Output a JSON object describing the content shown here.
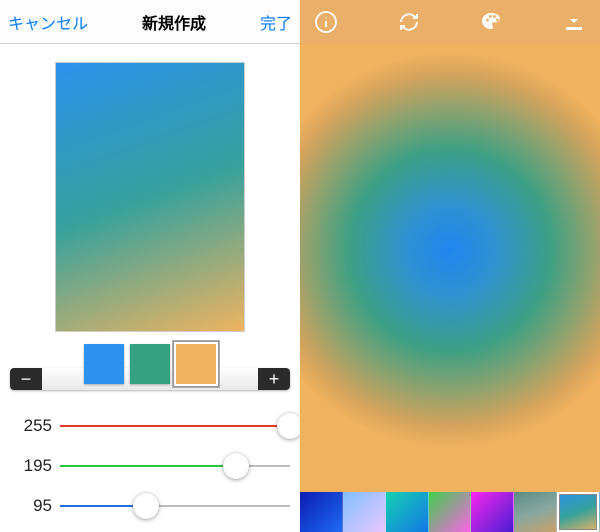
{
  "left": {
    "nav": {
      "cancel": "キャンセル",
      "title": "新規作成",
      "done": "完了"
    },
    "preview_gradient": "linear-gradient(160deg, #2b93ef 0%, #36a19c 50%, #f0b35f 100%)",
    "tray": {
      "minus": "−",
      "plus": "+"
    },
    "swatches": [
      {
        "color": "#2b93ef",
        "selected": false
      },
      {
        "color": "#36a17f",
        "selected": false
      },
      {
        "color": "#f0b35f",
        "selected": true
      }
    ],
    "sliders": [
      {
        "channel": "red",
        "value": 255,
        "pct": 100.0
      },
      {
        "channel": "green",
        "value": 195,
        "pct": 76.5
      },
      {
        "channel": "blue",
        "value": 95,
        "pct": 37.3
      }
    ]
  },
  "right": {
    "thumbs": [
      {
        "style": "linear-gradient(135deg,#0b1db0,#1f6af5)",
        "selected": false
      },
      {
        "style": "linear-gradient(135deg,#7fbfff,#e9c6ff)",
        "selected": false
      },
      {
        "style": "linear-gradient(135deg,#15d0b1,#1278e5)",
        "selected": false
      },
      {
        "style": "linear-gradient(135deg,#3ecf4a,#f963e6)",
        "selected": false
      },
      {
        "style": "linear-gradient(135deg,#f926f0,#4a1ed1)",
        "selected": false
      },
      {
        "style": "linear-gradient(160deg,#5a8a84,#88a79f,#c7a06a)",
        "selected": false
      },
      {
        "style": "linear-gradient(160deg,#2b93ef,#36a19c,#f0b35f)",
        "selected": true
      }
    ]
  }
}
